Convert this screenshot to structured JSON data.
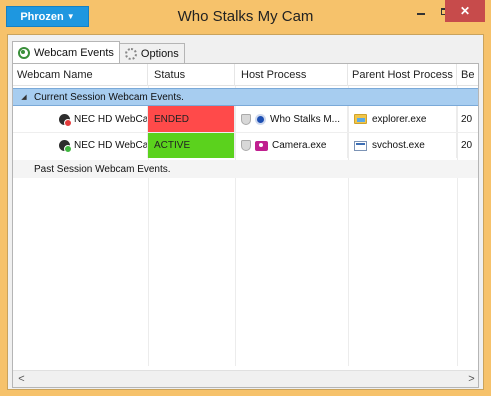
{
  "app": {
    "brand_button": "Phrozen",
    "brand_caret": "▼",
    "title": "Who Stalks My Cam",
    "close_glyph": "✕"
  },
  "tabs": [
    {
      "label": "Webcam Events",
      "active": true,
      "icon": "webcam-icon"
    },
    {
      "label": "Options",
      "active": false,
      "icon": "gear-icon"
    }
  ],
  "table": {
    "columns": [
      "Webcam Name",
      "Status",
      "Host Process",
      "Parent Host Process",
      "Be"
    ],
    "groups": {
      "current": {
        "label": "Current Session Webcam Events.",
        "toggle": "◢"
      },
      "past": {
        "label": "Past Session Webcam Events."
      }
    },
    "rows": [
      {
        "webcam_name": "NEC HD WebCam",
        "status": "ENDED",
        "host_process": "Who Stalks M...",
        "parent_host_process": "explorer.exe",
        "begin": "20"
      },
      {
        "webcam_name": "NEC HD WebCam",
        "status": "ACTIVE",
        "host_process": "Camera.exe",
        "parent_host_process": "svchost.exe",
        "begin": "20"
      }
    ]
  },
  "scrollbar": {
    "left": "<",
    "right": ">"
  },
  "colors": {
    "frame": "#f6c26b",
    "brand": "#1e97e0",
    "close": "#c74b4b",
    "group_highlight": "#a7cdf0",
    "status_ended": "#ff4a4a",
    "status_active": "#5bd21d"
  }
}
